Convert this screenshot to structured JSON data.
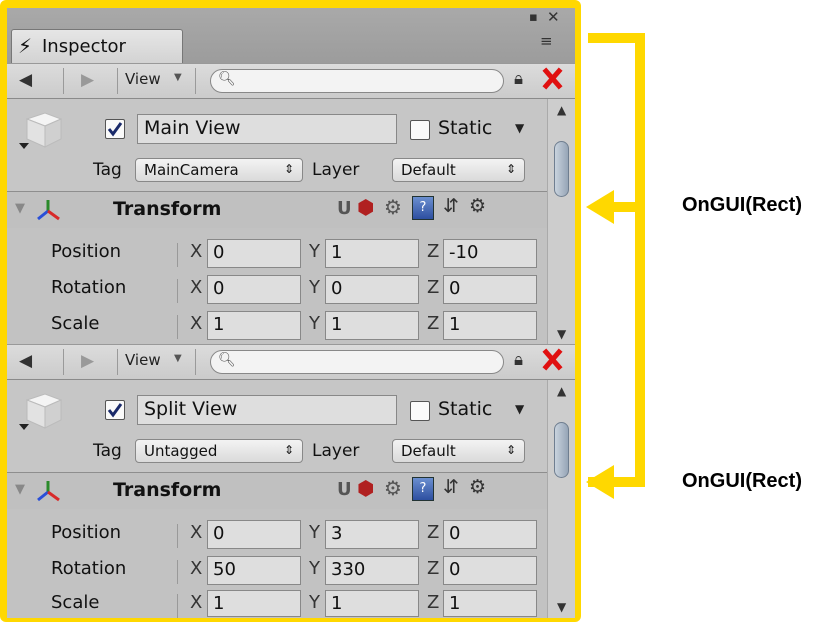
{
  "window": {
    "tab_label": "Inspector",
    "tab_icon": "lightning-icon",
    "window_buttons": {
      "maximize": "▪",
      "close": "✕",
      "menu": "≡"
    }
  },
  "panels": [
    {
      "toolbar": {
        "view_label": "View",
        "search_placeholder": "",
        "lock": "🔒"
      },
      "object": {
        "active": true,
        "name": "Main View",
        "static_label": "Static",
        "tag_label": "Tag",
        "tag_value": "MainCamera",
        "layer_label": "Layer",
        "layer_value": "Default"
      },
      "transform": {
        "title": "Transform",
        "rows": [
          {
            "label": "Position",
            "x": "0",
            "y": "1",
            "z": "-10"
          },
          {
            "label": "Rotation",
            "x": "0",
            "y": "0",
            "z": "0"
          },
          {
            "label": "Scale",
            "x": "1",
            "y": "1",
            "z": "1"
          }
        ]
      }
    },
    {
      "toolbar": {
        "view_label": "View",
        "search_placeholder": "",
        "lock": "🔒"
      },
      "object": {
        "active": true,
        "name": "Split View",
        "static_label": "Static",
        "tag_label": "Tag",
        "tag_value": "Untagged",
        "layer_label": "Layer",
        "layer_value": "Default"
      },
      "transform": {
        "title": "Transform",
        "rows": [
          {
            "label": "Position",
            "x": "0",
            "y": "3",
            "z": "0"
          },
          {
            "label": "Rotation",
            "x": "50",
            "y": "330",
            "z": "0"
          },
          {
            "label": "Scale",
            "x": "1",
            "y": "1",
            "z": "1"
          }
        ]
      }
    }
  ],
  "axes": {
    "x": "X",
    "y": "Y",
    "z": "Z"
  },
  "annotations": [
    {
      "label": "OnGUI(Rect)"
    },
    {
      "label": "OnGUI(Rect)"
    }
  ],
  "colors": {
    "highlight": "#FFD800",
    "close_red": "#E01010",
    "window_bg": "#C2C2C2"
  }
}
